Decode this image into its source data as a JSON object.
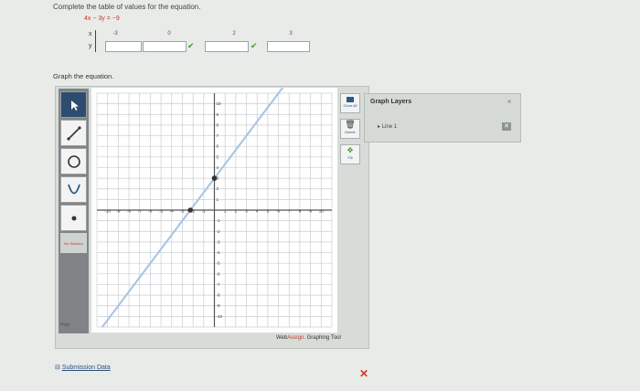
{
  "instructions": "Complete the table of values for the equation.",
  "equation": "4x − 3y = −9",
  "table": {
    "x_label": "x",
    "y_label": "y",
    "x_values": [
      "-3",
      "0",
      "2",
      "3"
    ]
  },
  "graph_instruction": "Graph the equation.",
  "tools": {
    "no_solution_label": "No Solution",
    "help_label": "Help"
  },
  "right_tools": {
    "clear_all": "Clear All",
    "delete": "Delete",
    "fill": "Fill"
  },
  "graph_layers": {
    "title": "Graph Layers",
    "collapse": "«",
    "items": [
      "Line 1"
    ]
  },
  "brand": {
    "web": "Web",
    "assign": "Assign",
    "suffix": ". Graphing Tool"
  },
  "submission": {
    "icon": "⊟",
    "label": "Submission Data"
  },
  "close_mark": "✕",
  "checkmark": "✔",
  "graph": {
    "x_ticks": [
      "-10",
      "-9",
      "-8",
      "-7",
      "-6",
      "-5",
      "-4",
      "-3",
      "-2",
      "-1",
      "1",
      "2",
      "3",
      "4",
      "5",
      "6",
      "7",
      "8",
      "9",
      "10"
    ],
    "y_ticks": [
      "10",
      "9",
      "8",
      "7",
      "6",
      "5",
      "4",
      "3",
      "2",
      "1",
      "-1",
      "-2",
      "-3",
      "-4",
      "-5",
      "-6",
      "-7",
      "-8",
      "-9",
      "-10"
    ],
    "line_slope": 1.3333,
    "line_intercept": 3,
    "points": [
      {
        "x": -2.25,
        "y": 0
      },
      {
        "x": 0,
        "y": 3
      }
    ],
    "colors": {
      "line": "#a7c2e0",
      "grid": "#c8cdd2",
      "axis": "#555555",
      "point": "#333333"
    }
  }
}
